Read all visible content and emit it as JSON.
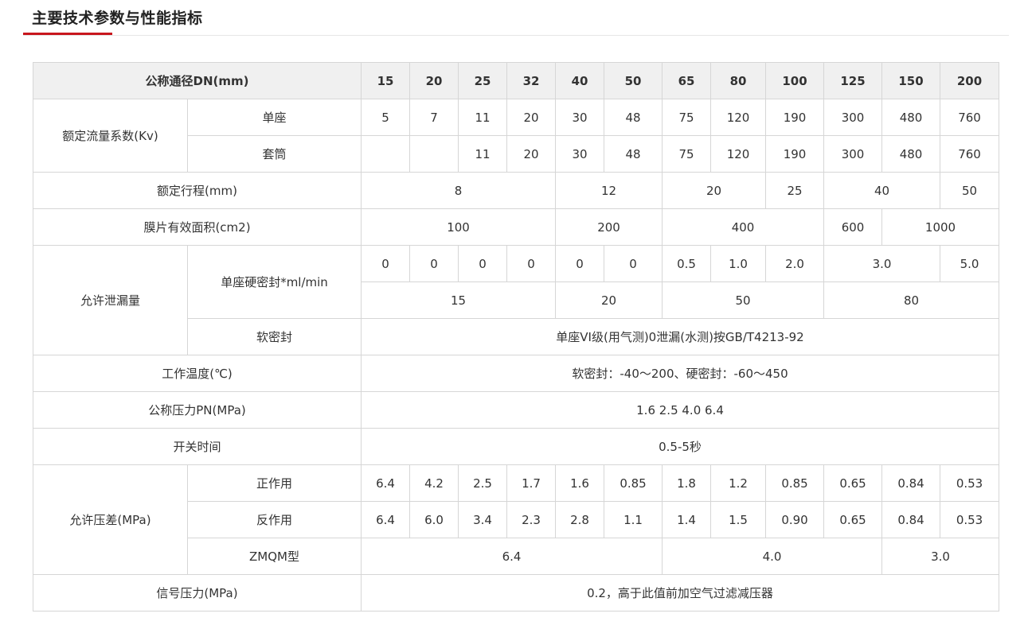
{
  "title": "主要技术参数与性能指标",
  "header": {
    "label": "公称通径DN(mm)",
    "sizes": [
      "15",
      "20",
      "25",
      "32",
      "40",
      "50",
      "65",
      "80",
      "100",
      "125",
      "150",
      "200"
    ]
  },
  "kv": {
    "label": "额定流量系数(Kv)",
    "single": {
      "label": "单座",
      "values": [
        "5",
        "7",
        "11",
        "20",
        "30",
        "48",
        "75",
        "120",
        "190",
        "300",
        "480",
        "760"
      ]
    },
    "sleeve": {
      "label": "套筒",
      "values": [
        "11",
        "20",
        "30",
        "48",
        "75",
        "120",
        "190",
        "300",
        "480",
        "760"
      ]
    }
  },
  "stroke": {
    "label": "额定行程(mm)",
    "values": [
      "8",
      "12",
      "20",
      "25",
      "40",
      "50"
    ]
  },
  "area": {
    "label": "膜片有效面积(cm2)",
    "values": [
      "100",
      "200",
      "400",
      "600",
      "1000"
    ]
  },
  "leak": {
    "label": "允许泄漏量",
    "hard": {
      "label": "单座硬密封*ml/min",
      "row1": [
        "0",
        "0",
        "0",
        "0",
        "0",
        "0",
        "0.5",
        "1.0",
        "2.0",
        "3.0",
        "5.0"
      ],
      "row2": [
        "15",
        "20",
        "50",
        "80"
      ]
    },
    "soft": {
      "label": "软密封",
      "value": "单座VI级(用气测)0泄漏(水测)按GB/T4213-92"
    }
  },
  "temp": {
    "label": "工作温度(℃)",
    "value": "软密封：-40～200、硬密封：-60～450"
  },
  "pressure": {
    "label": "公称压力PN(MPa)",
    "value": "1.6 2.5 4.0 6.4"
  },
  "switch_time": {
    "label": "开关时间",
    "value": "0.5-5秒"
  },
  "dp": {
    "label": "允许压差(MPa)",
    "forward": {
      "label": "正作用",
      "values": [
        "6.4",
        "4.2",
        "2.5",
        "1.7",
        "1.6",
        "0.85",
        "1.8",
        "1.2",
        "0.85",
        "0.65",
        "0.84",
        "0.53"
      ]
    },
    "reverse": {
      "label": "反作用",
      "values": [
        "6.4",
        "6.0",
        "3.4",
        "2.3",
        "2.8",
        "1.1",
        "1.4",
        "1.5",
        "0.90",
        "0.65",
        "0.84",
        "0.53"
      ]
    },
    "zmqm": {
      "label": "ZMQM型",
      "values": [
        "6.4",
        "4.0",
        "3.0"
      ]
    }
  },
  "signal": {
    "label": "信号压力(MPa)",
    "value": "0.2，高于此值前加空气过滤减压器"
  }
}
